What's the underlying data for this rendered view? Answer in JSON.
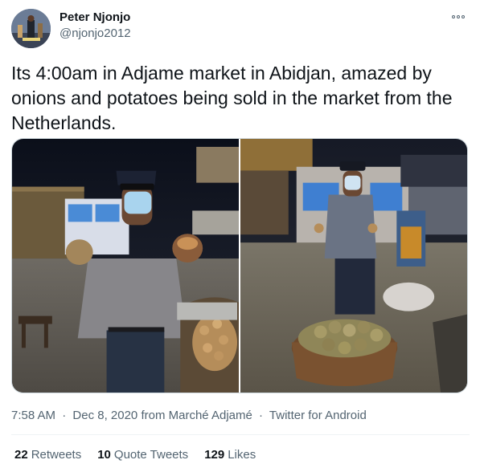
{
  "author": {
    "name": "Peter Njonjo",
    "handle": "@njonjo2012"
  },
  "tweet": {
    "text": "Its 4:00am in Adjame market in Abidjan, amazed by onions and potatoes being sold in the market from the Netherlands."
  },
  "meta": {
    "time": "7:58 AM",
    "separator": "·",
    "date_location": "Dec 8, 2020 from Marché Adjamé",
    "source": "Twitter for Android"
  },
  "stats": {
    "retweets_count": "22",
    "retweets_label": "Retweets",
    "quotes_count": "10",
    "quotes_label": "Quote Tweets",
    "likes_count": "129",
    "likes_label": "Likes"
  },
  "icons": {
    "more": "more-horizontal-icon"
  }
}
